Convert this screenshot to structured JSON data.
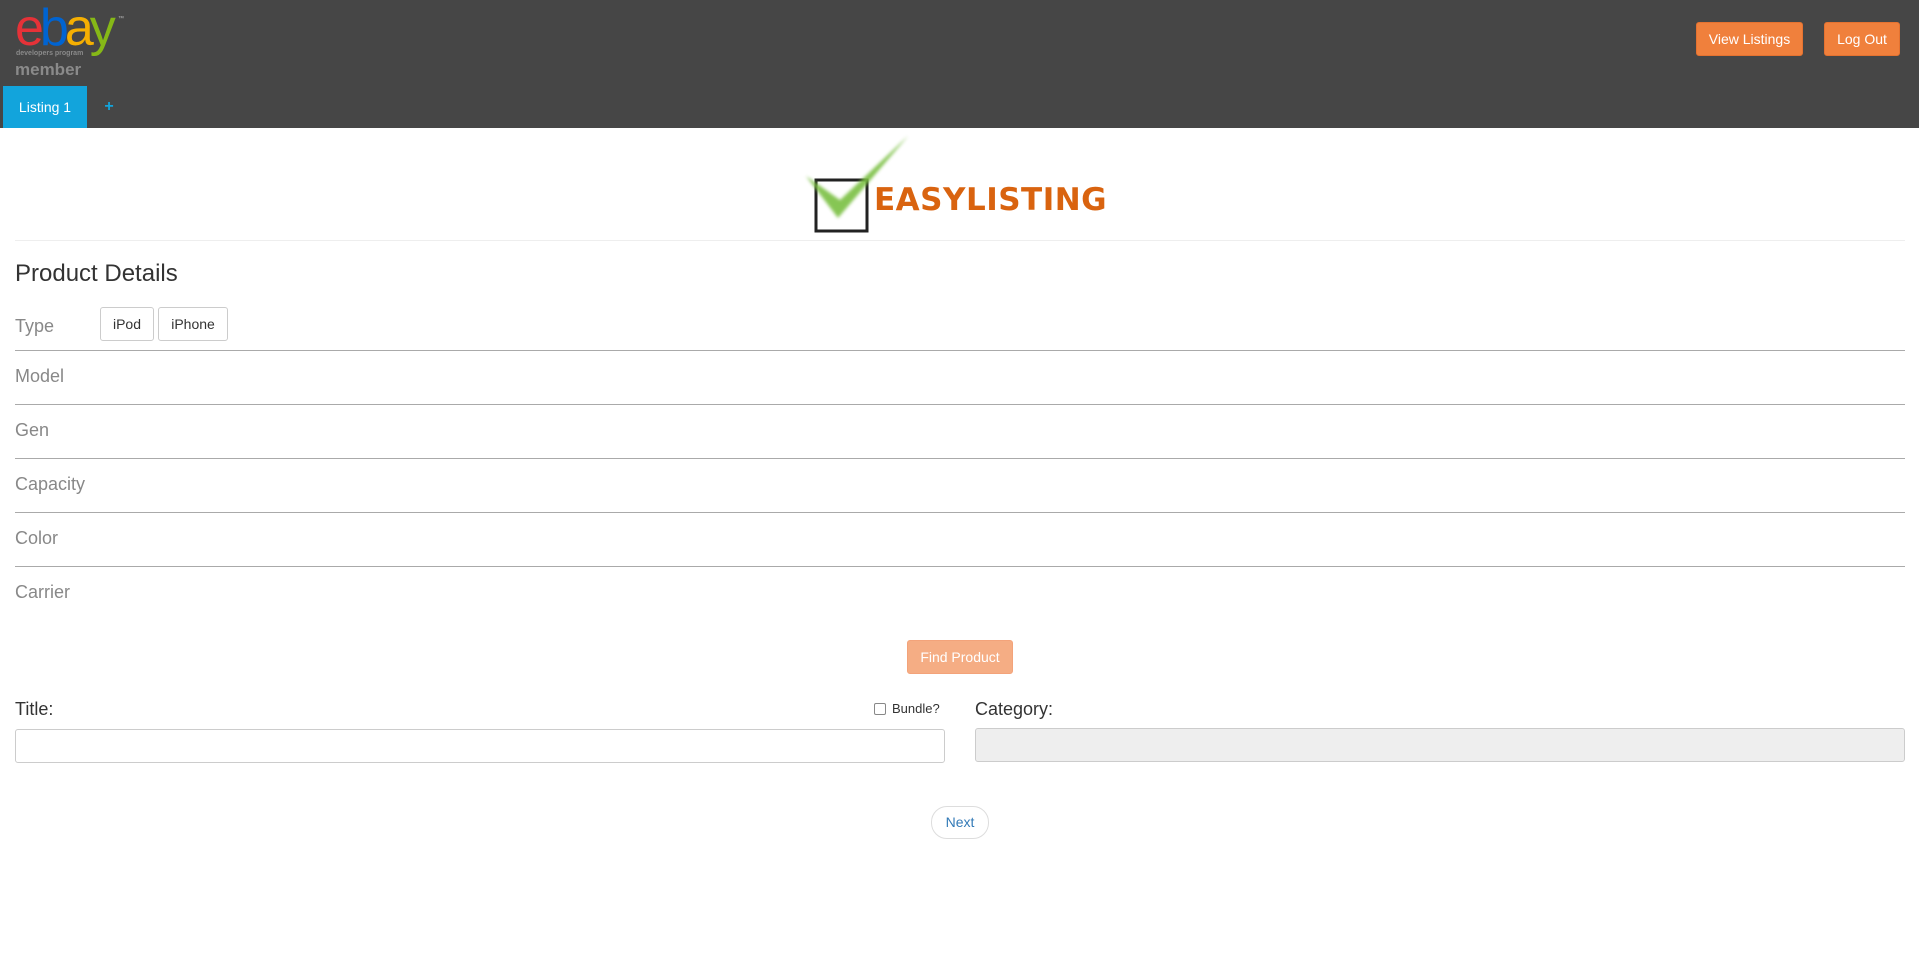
{
  "header": {
    "logo_letters": [
      "e",
      "b",
      "a",
      "y"
    ],
    "logo_trademark": "™",
    "logo_subtitle": "developers program",
    "logo_member": "member",
    "view_listings_label": "View Listings",
    "logout_label": "Log Out",
    "tabs": [
      {
        "label": "Listing 1",
        "active": true
      }
    ],
    "add_tab_label": "+"
  },
  "brand": {
    "text": "EASYLISTING"
  },
  "product_details": {
    "title": "Product Details",
    "type_label": "Type",
    "type_options": [
      "iPod",
      "iPhone"
    ],
    "rows": [
      "Model",
      "Gen",
      "Capacity",
      "Color",
      "Carrier"
    ]
  },
  "find_product_label": "Find Product",
  "title_field": {
    "label": "Title:",
    "value": "",
    "bundle_label": "Bundle?",
    "bundle_checked": false
  },
  "category_field": {
    "label": "Category:",
    "value": ""
  },
  "next_label": "Next",
  "colors": {
    "header_bg": "#464646",
    "accent_orange": "#f0803c",
    "tab_blue": "#12a4dc",
    "brand_orange": "#d9630f",
    "check_green": "#7ac043"
  }
}
